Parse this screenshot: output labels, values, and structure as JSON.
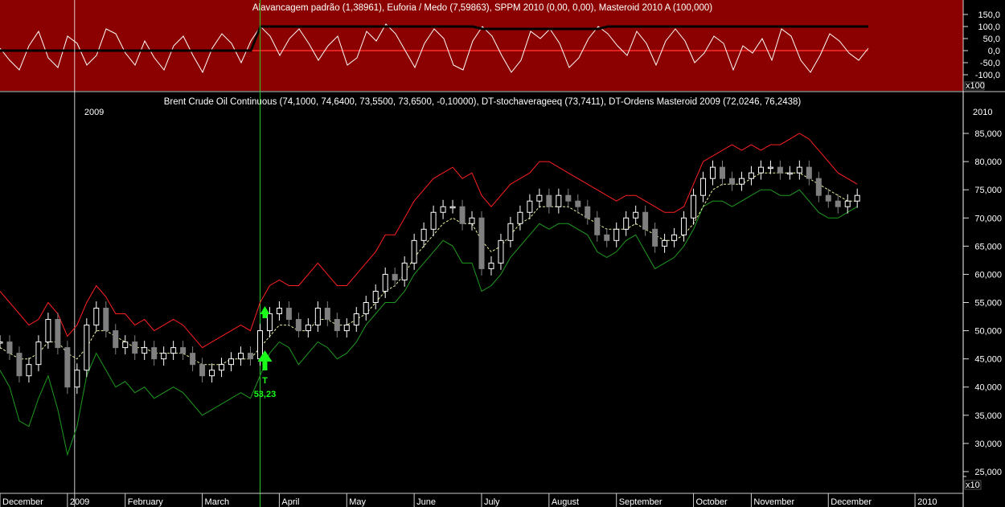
{
  "chart_data": [
    {
      "type": "line",
      "title": "Alavancagem padrão (1,38961), Euforia / Medo (7,59863), SPPM 2010 (0,00, 0,00), Masteroid 2010 A (100,000)",
      "ylim": [
        -150,
        150
      ],
      "y_ticks": [
        "150,0",
        "100,0",
        "50,0",
        "0,0",
        "-50,0",
        "-100,0"
      ],
      "y_tick_values": [
        150,
        100,
        50,
        0,
        -50,
        -100
      ],
      "scale_note": "x100",
      "background": "#8b0000",
      "series": [
        {
          "values": [
            10,
            -40,
            -80,
            20,
            80,
            -30,
            -70,
            60,
            30,
            -60,
            -20,
            90,
            70,
            -10,
            -60,
            40,
            -30,
            -80,
            20,
            60,
            -20,
            -90,
            10,
            70,
            30,
            -50,
            40,
            100,
            60,
            -20,
            50,
            90,
            30,
            -40,
            20,
            60,
            -60,
            -30,
            80,
            40,
            110,
            70,
            0,
            -70,
            30,
            90,
            50,
            -60,
            -80,
            40,
            100,
            60,
            -20,
            -90,
            -40,
            80,
            50,
            90,
            30,
            -70,
            -30,
            50,
            100,
            70,
            20,
            -20,
            80,
            30,
            -60,
            40,
            90,
            40,
            -50,
            -10,
            60,
            30,
            -80,
            20,
            -10,
            50,
            -40,
            90,
            60,
            -40,
            -90,
            -20,
            70,
            40,
            -10,
            -40,
            10
          ],
          "color": "#ffffff"
        },
        {
          "values": [
            0,
            0,
            0,
            0,
            0,
            0,
            0,
            0,
            0,
            0,
            0,
            0,
            0,
            0,
            0,
            0,
            0,
            0,
            0,
            0,
            0,
            0,
            0,
            0,
            0,
            0,
            0,
            100,
            100,
            100,
            100,
            100,
            100,
            100,
            100,
            100,
            100,
            100,
            100,
            100,
            100,
            100,
            100,
            100,
            100,
            100,
            100,
            100,
            100,
            100,
            90,
            90,
            90,
            90,
            90,
            90,
            90,
            90,
            90,
            90,
            90,
            90,
            90,
            100,
            100,
            100,
            100,
            100,
            100,
            100,
            100,
            100,
            100,
            100,
            100,
            100,
            100,
            100,
            100,
            100,
            100,
            100,
            100,
            100,
            100,
            100,
            100,
            100,
            100,
            100,
            100
          ],
          "color": "#000000"
        }
      ],
      "x_range": [
        0,
        90
      ]
    },
    {
      "type": "candlestick",
      "title": "Brent Crude Oil Continuous (74,1000, 74,6400, 73,5500, 73,6500, -0,10000), DT-stochaverageeq (73,7411), DT-Ordens Masteroid 2009 (72,0246, 76,2438)",
      "ylim": [
        22,
        88
      ],
      "y_ticks": [
        "85,000",
        "80,000",
        "75,000",
        "70,000",
        "65,000",
        "60,000",
        "55,000",
        "50,000",
        "45,000",
        "40,000",
        "35,000",
        "30,000",
        "25,000"
      ],
      "y_tick_values": [
        85,
        80,
        75,
        70,
        65,
        60,
        55,
        50,
        45,
        40,
        35,
        30,
        25
      ],
      "scale_note": "x10",
      "year_labels": [
        {
          "label": "2009",
          "at": 8
        },
        {
          "label": "2010",
          "at": 100
        }
      ],
      "x_months": [
        {
          "label": "December",
          "at": 0
        },
        {
          "label": "2009",
          "at": 8
        },
        {
          "label": "February",
          "at": 14
        },
        {
          "label": "March",
          "at": 22
        },
        {
          "label": "April",
          "at": 30
        },
        {
          "label": "May",
          "at": 37
        },
        {
          "label": "June",
          "at": 44
        },
        {
          "label": "July",
          "at": 51
        },
        {
          "label": "August",
          "at": 58
        },
        {
          "label": "September",
          "at": 65
        },
        {
          "label": "October",
          "at": 73
        },
        {
          "label": "November",
          "at": 79
        },
        {
          "label": "December",
          "at": 87
        },
        {
          "label": "2010",
          "at": 96
        }
      ],
      "x_range": [
        0,
        100
      ],
      "close": [
        48,
        46,
        42,
        44,
        48,
        52,
        47,
        40,
        43,
        51,
        54,
        50,
        47,
        48,
        46,
        47,
        45,
        46,
        47,
        46,
        44,
        42,
        43,
        44,
        45,
        46,
        45,
        50,
        53,
        54,
        52,
        50,
        51,
        54,
        52,
        50,
        51,
        53,
        55,
        57,
        60,
        59,
        62,
        66,
        68,
        71,
        72,
        72,
        69,
        70,
        61,
        62,
        66,
        69,
        71,
        73,
        74,
        72,
        74,
        73,
        72,
        70,
        67,
        66,
        68,
        70,
        71,
        68,
        65,
        66,
        67,
        70,
        74,
        77,
        79,
        77,
        76,
        77,
        78,
        79,
        79,
        78,
        78,
        79,
        77,
        74,
        73,
        72,
        73,
        74
      ],
      "upper_band": [
        57,
        55,
        53,
        51,
        52,
        55,
        53,
        49,
        51,
        55,
        58,
        56,
        53,
        53,
        51,
        52,
        50,
        51,
        52,
        51,
        49,
        47,
        48,
        49,
        50,
        51,
        50,
        55,
        58,
        59,
        58,
        58,
        60,
        62,
        60,
        58,
        58,
        60,
        62,
        64,
        67,
        67,
        70,
        73,
        75,
        77,
        78,
        79,
        77,
        78,
        74,
        72,
        74,
        76,
        77,
        78,
        80,
        80,
        79,
        78,
        77,
        76,
        75,
        74,
        73,
        74,
        74,
        73,
        72,
        71,
        71,
        72,
        76,
        80,
        81,
        82,
        83,
        82,
        83,
        82,
        83,
        83,
        84,
        85,
        84,
        82,
        80,
        78,
        77,
        76
      ],
      "lower_band": [
        43,
        40,
        34,
        33,
        38,
        42,
        36,
        28,
        33,
        42,
        46,
        43,
        40,
        41,
        39,
        40,
        38,
        39,
        40,
        39,
        37,
        35,
        36,
        37,
        38,
        39,
        38,
        42,
        46,
        48,
        47,
        44,
        46,
        48,
        47,
        45,
        46,
        48,
        51,
        53,
        55,
        55,
        57,
        60,
        62,
        64,
        66,
        65,
        62,
        62,
        57,
        58,
        60,
        63,
        65,
        67,
        69,
        68,
        69,
        69,
        68,
        67,
        64,
        63,
        64,
        66,
        67,
        64,
        61,
        62,
        63,
        65,
        68,
        72,
        73,
        73,
        72,
        73,
        74,
        75,
        75,
        74,
        74,
        75,
        73,
        71,
        70,
        70,
        71,
        72
      ],
      "stoch_average": [
        47,
        46,
        45,
        45,
        46,
        48,
        48,
        46,
        45,
        47,
        50,
        50,
        49,
        48,
        47,
        47,
        46,
        46,
        46,
        46,
        45,
        44,
        44,
        44,
        45,
        45,
        45,
        47,
        49,
        51,
        51,
        50,
        50,
        52,
        52,
        51,
        51,
        52,
        53,
        55,
        57,
        58,
        60,
        63,
        65,
        67,
        69,
        70,
        69,
        69,
        66,
        64,
        65,
        67,
        69,
        70,
        72,
        72,
        72,
        72,
        71,
        70,
        69,
        68,
        68,
        68,
        69,
        68,
        67,
        66,
        66,
        67,
        69,
        72,
        75,
        76,
        76,
        76,
        77,
        78,
        78,
        78,
        78,
        78,
        77,
        76,
        75,
        74,
        73,
        73
      ],
      "signal": {
        "label": "T",
        "value": "53,23",
        "at": 27,
        "marker_value": 53.5,
        "color": "#19ff19"
      },
      "colors": {
        "price": "#ffffff",
        "bearish": "#7f7f7f",
        "upper_band": "#ff2020",
        "lower_band": "#1e9a1e",
        "stoch_average": "#f0f0a0",
        "cursor": "#2ecc2e"
      }
    }
  ]
}
